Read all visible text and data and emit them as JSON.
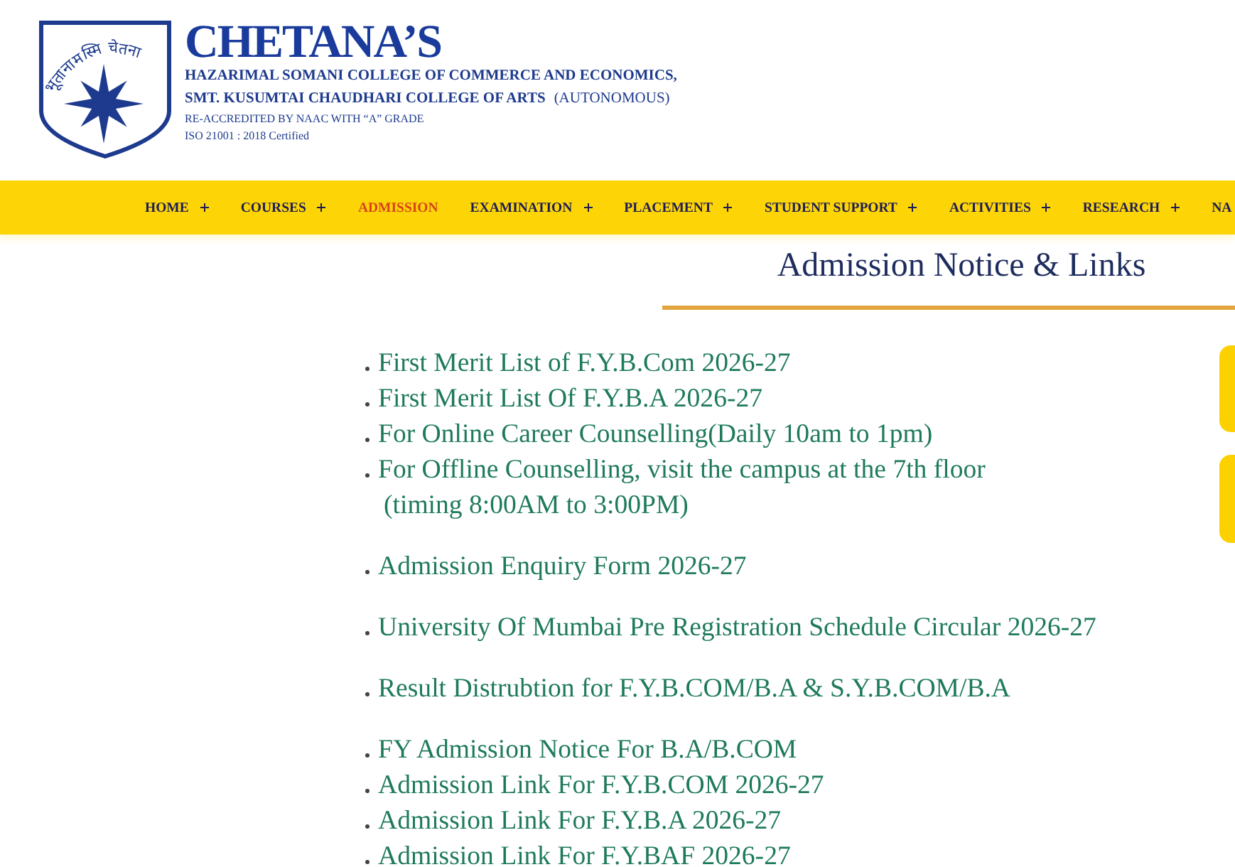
{
  "header": {
    "logo": {
      "motto": "भूतानामस्मि चेतना"
    },
    "title": "CHETANA’S",
    "college_lines": [
      "HAZARIMAL SOMANI COLLEGE OF COMMERCE AND ECONOMICS,",
      "SMT. KUSUMTAI CHAUDHARI COLLEGE OF ARTS"
    ],
    "status": "(AUTONOMOUS)",
    "accreditation": "RE-ACCREDITED BY NAAC WITH “A” GRADE",
    "certification": "ISO 21001 : 2018 Certified"
  },
  "nav": {
    "items": [
      {
        "label": "HOME",
        "has_submenu": true,
        "selected": false
      },
      {
        "label": "COURSES",
        "has_submenu": true,
        "selected": false
      },
      {
        "label": "ADMISSION",
        "has_submenu": false,
        "selected": true
      },
      {
        "label": "EXAMINATION",
        "has_submenu": true,
        "selected": false
      },
      {
        "label": "PLACEMENT",
        "has_submenu": true,
        "selected": false
      },
      {
        "label": "STUDENT SUPPORT",
        "has_submenu": true,
        "selected": false
      },
      {
        "label": "ACTIVITIES",
        "has_submenu": true,
        "selected": false
      },
      {
        "label": "RESEARCH",
        "has_submenu": true,
        "selected": false
      },
      {
        "label": "NA",
        "has_submenu": false,
        "selected": false
      }
    ]
  },
  "section": {
    "title": "Admission Notice & Links",
    "groups": [
      {
        "items": [
          {
            "text": "First Merit List of F.Y.B.Com 2026-27"
          },
          {
            "text": "First Merit List Of F.Y.B.A 2026-27"
          },
          {
            "text": "For Online Career Counselling(Daily 10am to 1pm)"
          },
          {
            "text": "For Offline Counselling, visit the campus at the 7th floor",
            "note": "(timing 8:00AM to 3:00PM)"
          }
        ]
      },
      {
        "items": [
          {
            "text": "Admission Enquiry Form 2026-27"
          }
        ]
      },
      {
        "items": [
          {
            "text": "University Of Mumbai Pre Registration Schedule Circular 2026-27"
          }
        ]
      },
      {
        "items": [
          {
            "text": "Result Distrubtion for F.Y.B.COM/B.A & S.Y.B.COM/B.A"
          }
        ]
      },
      {
        "items": [
          {
            "text": "FY Admission Notice For B.A/B.COM"
          },
          {
            "text": "Admission Link For F.Y.B.COM 2026-27"
          },
          {
            "text": "Admission Link For F.Y.B.A 2026-27"
          },
          {
            "text": "Admission Link For F.Y.BAF 2026-27"
          }
        ]
      }
    ]
  }
}
